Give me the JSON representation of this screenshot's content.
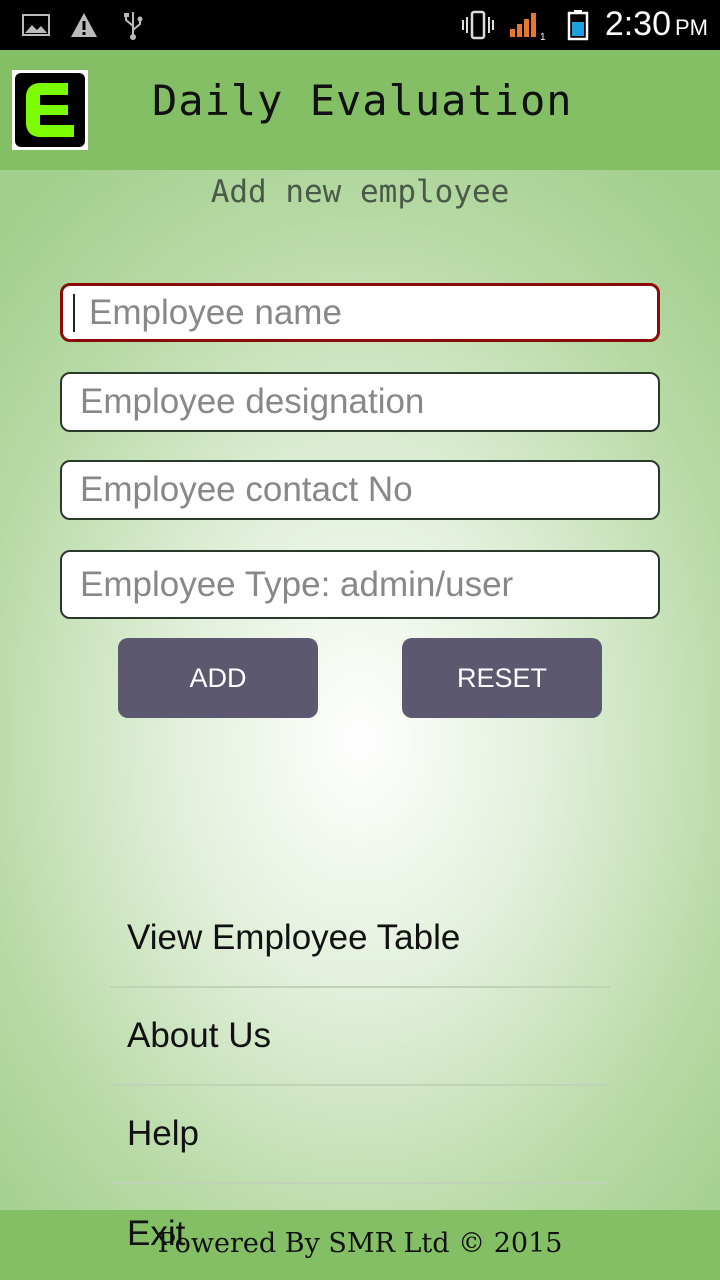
{
  "status_bar": {
    "time": "2:30",
    "ampm": "PM",
    "signal_sim": "1",
    "icons": [
      "image-icon",
      "warning-icon",
      "usb-icon",
      "vibrate-icon",
      "signal-icon",
      "battery-icon"
    ]
  },
  "app_bar": {
    "logo_letter": "E",
    "title": "Daily Evaluation",
    "background": "#84bf66"
  },
  "form": {
    "heading": "Add new employee",
    "fields": [
      {
        "placeholder": "Employee name",
        "value": ""
      },
      {
        "placeholder": "Employee designation",
        "value": ""
      },
      {
        "placeholder": "Employee contact No",
        "value": ""
      },
      {
        "placeholder": "Employee Type: admin/user",
        "value": ""
      }
    ],
    "add_label": "ADD",
    "reset_label": "RESET"
  },
  "menu": {
    "items": [
      {
        "label": "View Employee Table"
      },
      {
        "label": "About Us"
      },
      {
        "label": "Help"
      },
      {
        "label": "Exit"
      }
    ]
  },
  "footer": {
    "text": "Powered By SMR Ltd © 2015"
  },
  "colors": {
    "accent_green": "#84bf66",
    "logo_green": "#7cfc00",
    "button": "#5b5870",
    "focus_border": "#8b0a0a"
  }
}
